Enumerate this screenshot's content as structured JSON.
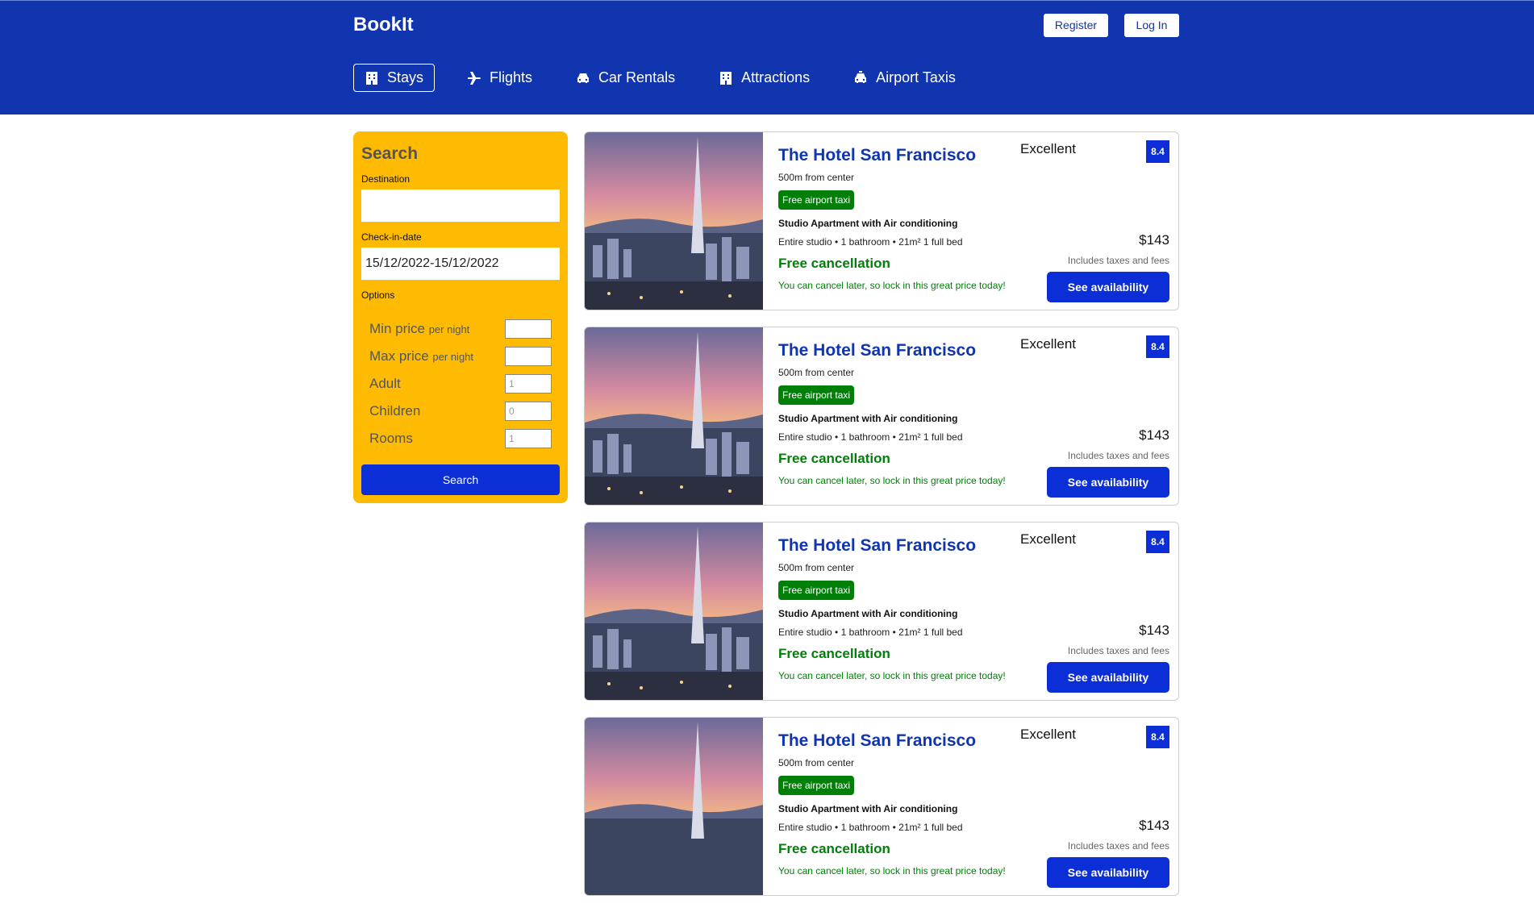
{
  "app": {
    "brand": "BookIt"
  },
  "header": {
    "register_label": "Register",
    "login_label": "Log In"
  },
  "nav": {
    "items": [
      {
        "label": "Stays",
        "icon": "building-icon"
      },
      {
        "label": "Flights",
        "icon": "plane-icon"
      },
      {
        "label": "Car Rentals",
        "icon": "car-icon"
      },
      {
        "label": "Attractions",
        "icon": "building-icon"
      },
      {
        "label": "Airport Taxis",
        "icon": "taxi-icon"
      }
    ]
  },
  "search": {
    "title": "Search",
    "destination_label": "Destination",
    "destination_value": "",
    "checkin_label": "Check-in-date",
    "checkin_value": "15/12/2022-15/12/2022",
    "options_label": "Options",
    "options": {
      "min_price": {
        "label": "Min price",
        "suffix": "per night",
        "value": ""
      },
      "max_price": {
        "label": "Max price",
        "suffix": "per night",
        "value": ""
      },
      "adult": {
        "label": "Adult",
        "placeholder": "1"
      },
      "children": {
        "label": "Children",
        "placeholder": "0"
      },
      "rooms": {
        "label": "Rooms",
        "placeholder": "1"
      }
    },
    "button_label": "Search"
  },
  "results": [
    {
      "title": "The Hotel San Francisco",
      "distance": "500m from center",
      "taxi": "Free airport taxi",
      "room": "Studio Apartment with Air conditioning",
      "features": "Entire studio • 1 bathroom • 21m² 1 full bed",
      "cancel": "Free cancellation",
      "cancel_sub": "You can cancel later, so lock in this great price today!",
      "rating": "Excellent",
      "score": "8.4",
      "price": "$143",
      "taxes": "Includes taxes and fees",
      "button": "See availability"
    },
    {
      "title": "The Hotel San Francisco",
      "distance": "500m from center",
      "taxi": "Free airport taxi",
      "room": "Studio Apartment with Air conditioning",
      "features": "Entire studio • 1 bathroom • 21m² 1 full bed",
      "cancel": "Free cancellation",
      "cancel_sub": "You can cancel later, so lock in this great price today!",
      "rating": "Excellent",
      "score": "8.4",
      "price": "$143",
      "taxes": "Includes taxes and fees",
      "button": "See availability"
    },
    {
      "title": "The Hotel San Francisco",
      "distance": "500m from center",
      "taxi": "Free airport taxi",
      "room": "Studio Apartment with Air conditioning",
      "features": "Entire studio • 1 bathroom • 21m² 1 full bed",
      "cancel": "Free cancellation",
      "cancel_sub": "You can cancel later, so lock in this great price today!",
      "rating": "Excellent",
      "score": "8.4",
      "price": "$143",
      "taxes": "Includes taxes and fees",
      "button": "See availability"
    },
    {
      "title": "The Hotel San Francisco",
      "distance": "500m from center",
      "taxi": "Free airport taxi",
      "room": "Studio Apartment with Air conditioning",
      "features": "Entire studio • 1 bathroom • 21m² 1 full bed",
      "cancel": "Free cancellation",
      "cancel_sub": "You can cancel later, so lock in this great price today!",
      "rating": "Excellent",
      "score": "8.4",
      "price": "$143",
      "taxes": "Includes taxes and fees",
      "button": "See availability"
    }
  ]
}
